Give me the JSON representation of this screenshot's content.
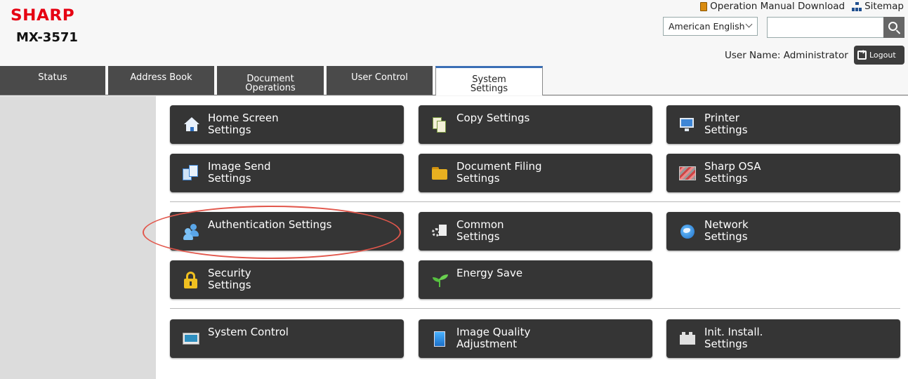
{
  "header": {
    "brand": "SHARP",
    "model": "MX-3571",
    "links": {
      "manual": "Operation Manual Download",
      "sitemap": "Sitemap"
    },
    "language": "American English",
    "search_value": "",
    "user_name": "User Name: Administrator",
    "logout_label": "Logout"
  },
  "tabs": [
    {
      "label": "Status"
    },
    {
      "label": "Address Book"
    },
    {
      "label": "Document\nOperations"
    },
    {
      "label": "User Control"
    },
    {
      "label": "System\nSettings",
      "active": true
    }
  ],
  "tiles": [
    {
      "label": "Home Screen\nSettings",
      "icon": "home-icon"
    },
    {
      "label": "Copy Settings",
      "icon": "copy-icon"
    },
    {
      "label": "Printer\nSettings",
      "icon": "printer-icon"
    },
    {
      "label": "Image Send\nSettings",
      "icon": "image-send-icon"
    },
    {
      "label": "Document Filing\nSettings",
      "icon": "folder-icon"
    },
    {
      "label": "Sharp OSA\nSettings",
      "icon": "osa-icon"
    },
    {
      "label": "Authentication Settings",
      "icon": "users-icon"
    },
    {
      "label": "Common\nSettings",
      "icon": "tools-icon"
    },
    {
      "label": "Network\nSettings",
      "icon": "globe-icon"
    },
    {
      "label": "Security\nSettings",
      "icon": "lock-icon"
    },
    {
      "label": "Energy Save",
      "icon": "leaf-icon"
    },
    {
      "label": "System Control",
      "icon": "system-control-icon"
    },
    {
      "label": "Image Quality\nAdjustment",
      "icon": "image-quality-icon"
    },
    {
      "label": "Init. Install.\nSettings",
      "icon": "init-install-icon"
    }
  ],
  "colors": {
    "brand_red": "#e60012",
    "tile_bg": "#353535",
    "tab_bg": "#4a4a4a",
    "active_tab_accent": "#3a6fb5",
    "highlight": "#e2574c"
  }
}
